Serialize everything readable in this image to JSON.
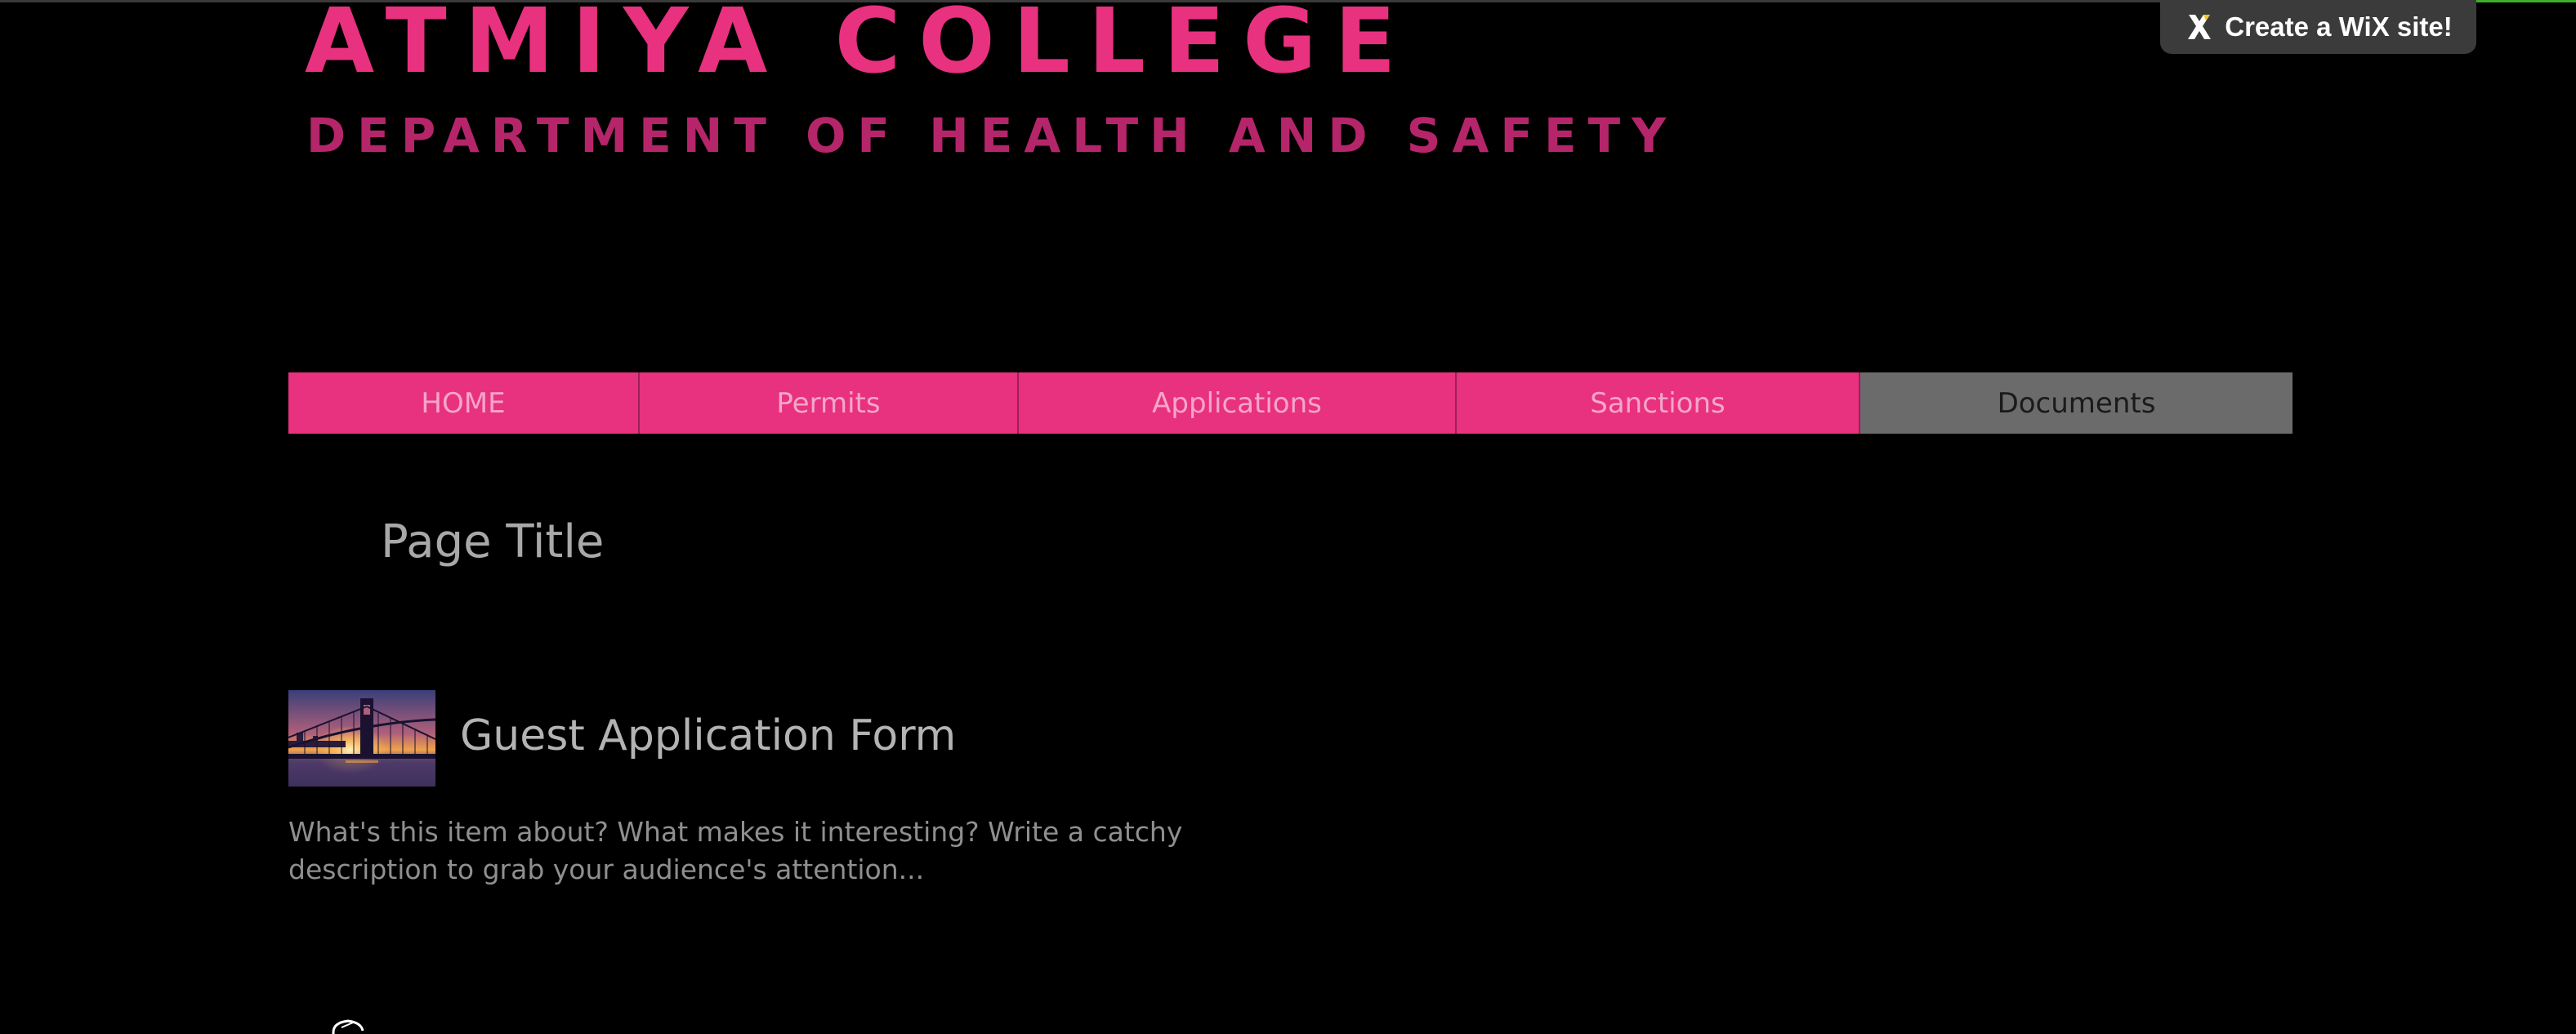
{
  "header": {
    "title": "ATMIYA COLLEGE",
    "subtitle": "DEPARTMENT OF HEALTH AND SAFETY"
  },
  "wix_banner": {
    "label": "Create a WiX site!",
    "icon": "wix-logo-icon"
  },
  "nav": {
    "items": [
      {
        "label": "HOME",
        "active": false
      },
      {
        "label": "Permits",
        "active": false
      },
      {
        "label": "Applications",
        "active": false
      },
      {
        "label": "Sanctions",
        "active": false
      },
      {
        "label": "Documents",
        "active": true
      }
    ]
  },
  "main": {
    "page_title": "Page Title",
    "items": [
      {
        "title": "Guest Application Form",
        "description": "What's this item about? What makes it interesting? Write a catchy description to grab your audience's attention...",
        "thumbnail": "bridge-sunset-image"
      }
    ]
  },
  "colors": {
    "background": "#000000",
    "accent": "#e8317f",
    "subtitle": "#b5256a",
    "nav_active": "#6b6b6b"
  }
}
